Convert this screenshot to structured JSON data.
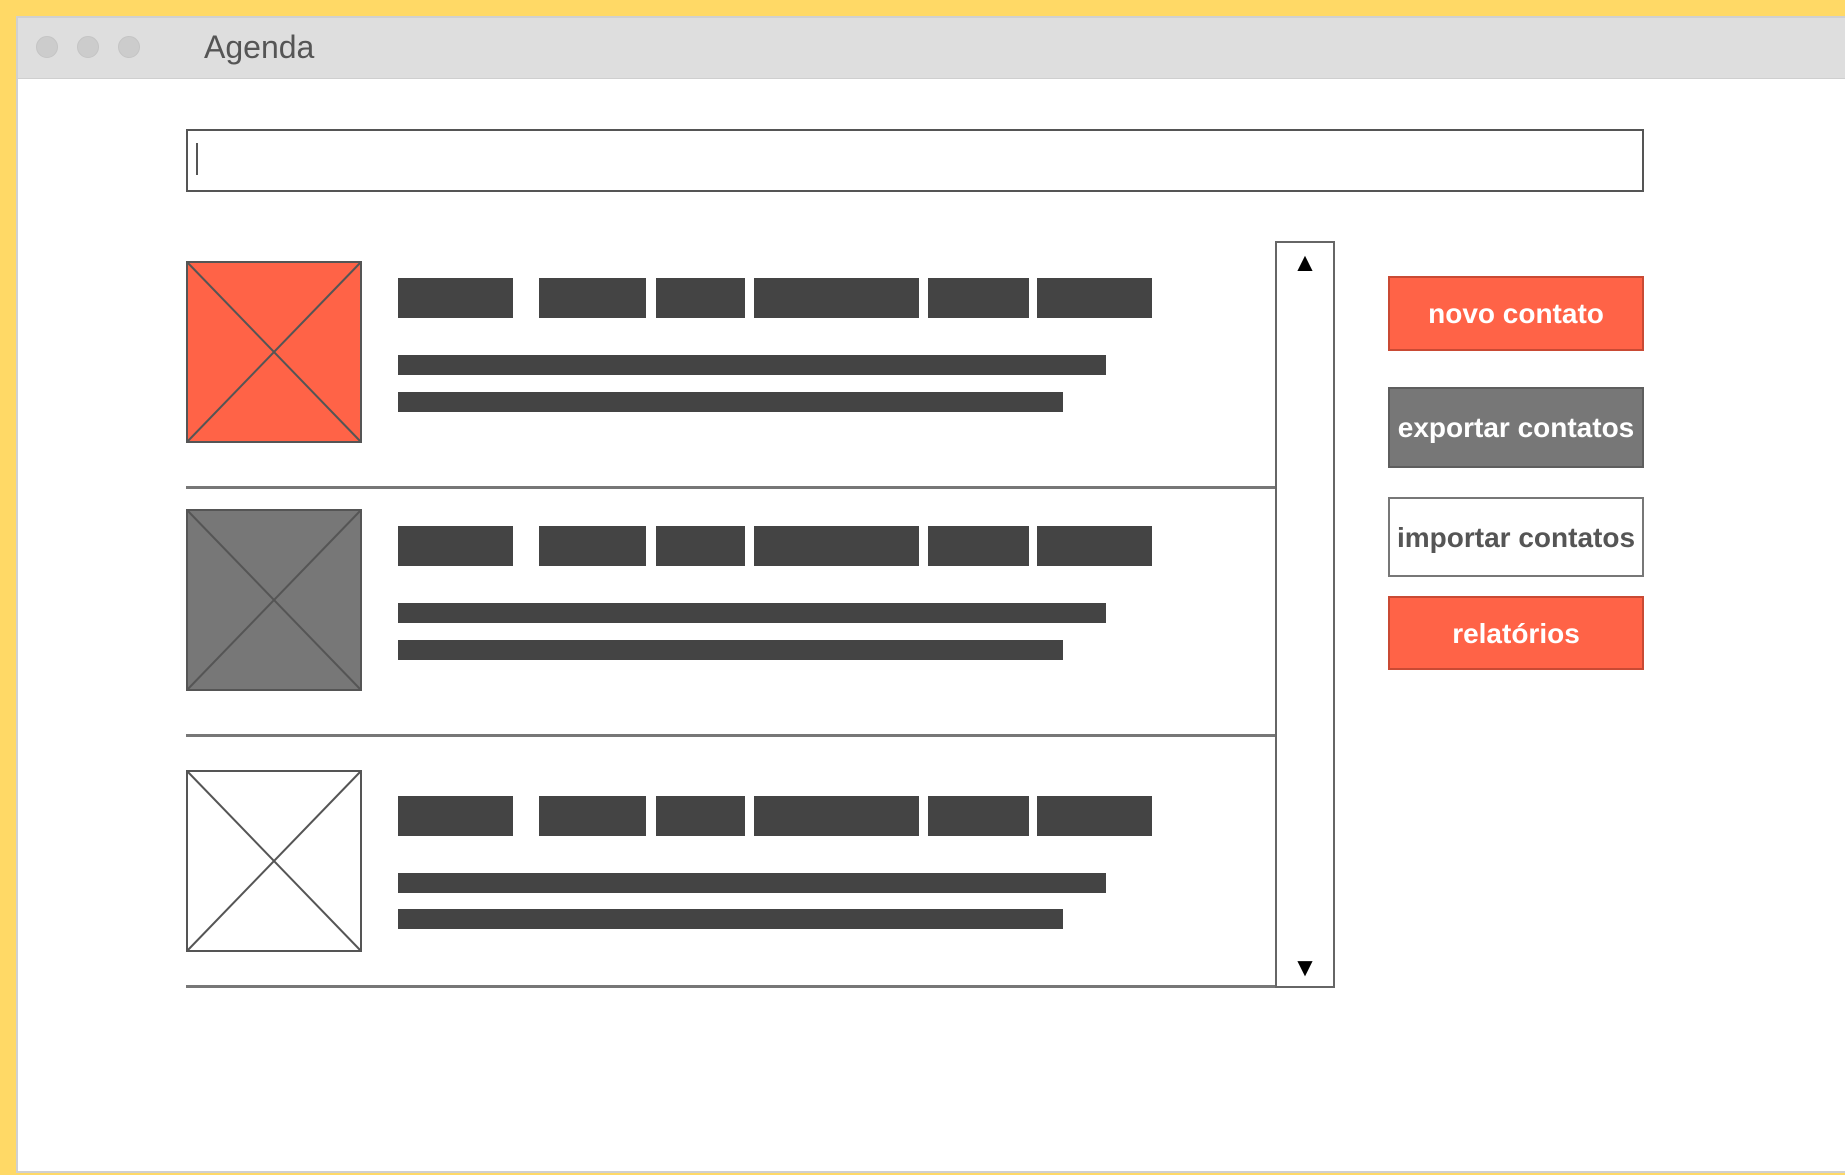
{
  "window": {
    "title": "Agenda"
  },
  "search": {
    "value": "",
    "placeholder": ""
  },
  "contacts": [
    {
      "avatar": "image-placeholder",
      "avatar_color": "#ff6347"
    },
    {
      "avatar": "image-placeholder",
      "avatar_color": "#777777"
    },
    {
      "avatar": "image-placeholder",
      "avatar_color": "#ffffff"
    }
  ],
  "scrollbar": {
    "up_arrow": "▲",
    "down_arrow": "▼"
  },
  "actions": {
    "new_contact": "novo contato",
    "export_contacts": "exportar contatos",
    "import_contacts": "importar contatos",
    "reports": "relatórios"
  },
  "colors": {
    "accent": "#ff6347",
    "secondary": "#777777",
    "background": "#ffd966"
  }
}
